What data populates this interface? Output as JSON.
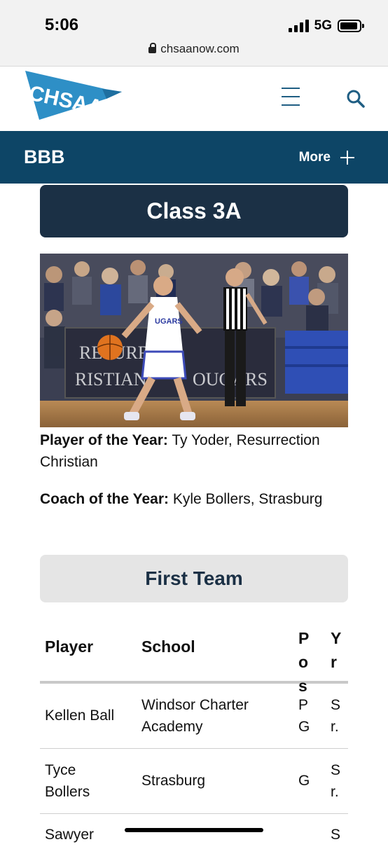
{
  "status_bar": {
    "time": "5:06",
    "network": "5G"
  },
  "browser": {
    "url": "chsaanow.com"
  },
  "header": {
    "logo_text": "CHSAA"
  },
  "nav": {
    "title": "BBB",
    "more_label": "More"
  },
  "section": {
    "title": "Class 3A"
  },
  "photo": {
    "jersey_text": "UGARS",
    "banner_line1": "RESURRE",
    "banner_line2": "RISTIAN",
    "banner_suffix": "OUGARS"
  },
  "awards": {
    "player_label": "Player of the Year:",
    "player_value": " Ty Yoder, Resurrection Christian",
    "coach_label": "Coach of the Year:",
    "coach_value": " Kyle Bollers, Strasburg"
  },
  "team": {
    "title": "First Team"
  },
  "table": {
    "headers": {
      "player": "Player",
      "school": "School",
      "pos": "Pos",
      "yr": "Yr"
    },
    "rows": [
      {
        "player": "Kellen Ball",
        "school": "Windsor Charter Academy",
        "pos": "PG",
        "yr": "Sr."
      },
      {
        "player": "Tyce Bollers",
        "school": "Strasburg",
        "pos": "G",
        "yr": "Sr."
      },
      {
        "player": "Sawyer",
        "school": "",
        "pos": "",
        "yr": "S"
      }
    ]
  },
  "colors": {
    "brand_dark": "#0d4566",
    "header_navy": "#1b3045",
    "logo_blue": "#2e8fc6"
  }
}
